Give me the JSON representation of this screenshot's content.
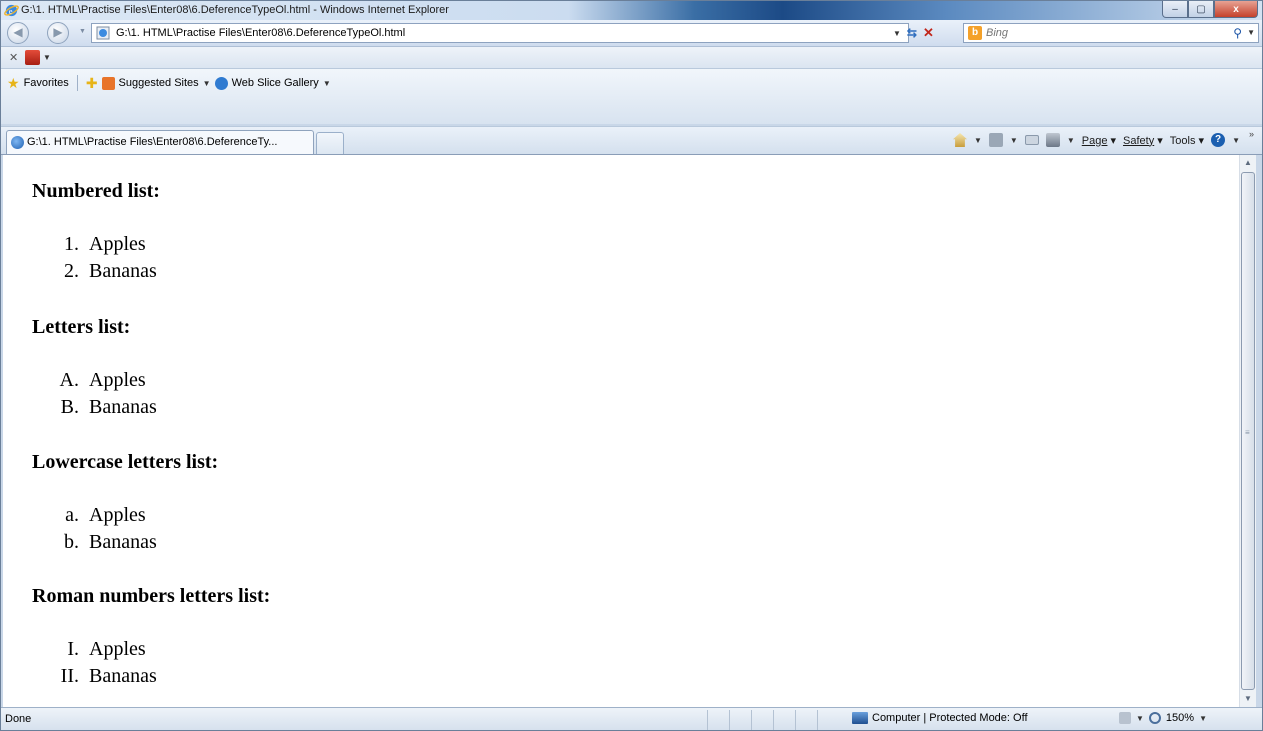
{
  "window": {
    "title": "G:\\1. HTML\\Practise Files\\Enter08\\6.DeferenceTypeOl.html - Windows Internet Explorer",
    "minimize": "–",
    "maximize": "▢",
    "close": "x"
  },
  "address": {
    "url": "G:\\1. HTML\\Practise Files\\Enter08\\6.DeferenceTypeOl.html"
  },
  "search": {
    "placeholder": "Bing"
  },
  "favorites_bar": {
    "favorites_label": "Favorites",
    "suggested_sites": "Suggested Sites",
    "web_slice_gallery": "Web Slice Gallery"
  },
  "tabs": [
    {
      "label": "G:\\1. HTML\\Practise Files\\Enter08\\6.DeferenceTy..."
    }
  ],
  "command_bar": {
    "page": "Page",
    "safety": "Safety",
    "tools": "Tools"
  },
  "page": {
    "sections": [
      {
        "heading": "Numbered list:",
        "markers": [
          "1.",
          "2."
        ],
        "items": [
          "Apples",
          "Bananas"
        ]
      },
      {
        "heading": "Letters list:",
        "markers": [
          "A.",
          "B."
        ],
        "items": [
          "Apples",
          "Bananas"
        ]
      },
      {
        "heading": "Lowercase letters list:",
        "markers": [
          "a.",
          "b."
        ],
        "items": [
          "Apples",
          "Bananas"
        ]
      },
      {
        "heading": "Roman numbers letters list:",
        "markers": [
          "I.",
          "II."
        ],
        "items": [
          "Apples",
          "Bananas"
        ]
      }
    ]
  },
  "status_bar": {
    "status": "Done",
    "zone": "Computer | Protected Mode: Off",
    "zoom": "150%"
  }
}
